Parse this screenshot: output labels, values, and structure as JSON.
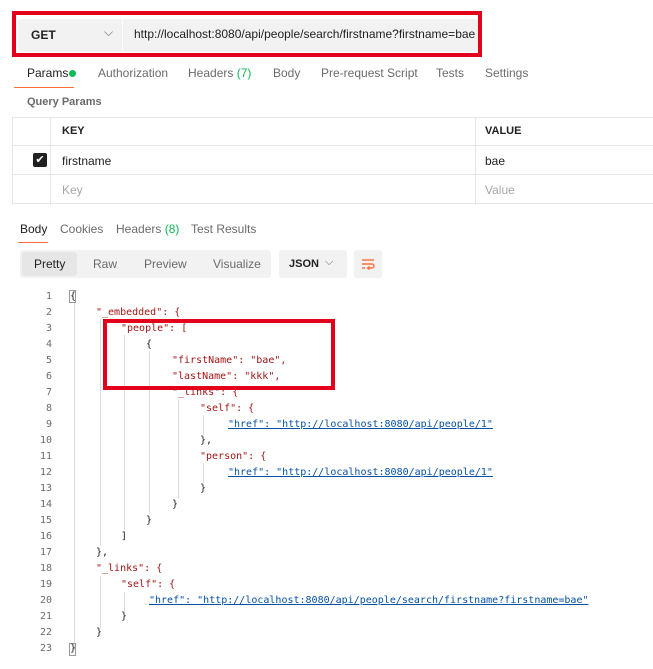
{
  "request": {
    "method": "GET",
    "url": "http://localhost:8080/api/people/search/firstname?firstname=bae"
  },
  "request_tabs": [
    {
      "label": "Params"
    },
    {
      "label": "Authorization"
    },
    {
      "label": "Headers",
      "count": "(7)"
    },
    {
      "label": "Body"
    },
    {
      "label": "Pre-request Script"
    },
    {
      "label": "Tests"
    },
    {
      "label": "Settings"
    }
  ],
  "query_params": {
    "title": "Query Params",
    "columns": [
      "KEY",
      "VALUE"
    ],
    "rows": [
      {
        "key": "firstname",
        "value": "bae",
        "checked": true
      }
    ],
    "placeholder": {
      "key": "Key",
      "value": "Value"
    }
  },
  "response_tabs": [
    {
      "label": "Body"
    },
    {
      "label": "Cookies"
    },
    {
      "label": "Headers",
      "count": "(8)"
    },
    {
      "label": "Test Results"
    }
  ],
  "view_modes": [
    "Pretty",
    "Raw",
    "Preview",
    "Visualize"
  ],
  "format": "JSON",
  "code_lines": [
    "{",
    "\"_embedded\": {",
    "\"people\": [",
    "{",
    "\"firstName\": \"bae\",",
    "\"lastName\": \"kkk\",",
    "\"_links\": {",
    "\"self\": {",
    "\"href\": \"http://localhost:8080/api/people/1\"",
    "},",
    "\"person\": {",
    "\"href\": \"http://localhost:8080/api/people/1\"",
    "}",
    "}",
    "}",
    "]",
    "},",
    "\"_links\": {",
    "\"self\": {",
    "\"href\": \"http://localhost:8080/api/people/search/firstname?firstname=bae\"",
    "}",
    "}",
    "}"
  ],
  "colors": {
    "accent": "#ff6c37",
    "count_green": "#0cbb52",
    "highlight_red": "#e2001a"
  },
  "icons": [
    "chevron-down-icon",
    "checkmark-icon",
    "wrap-lines-icon"
  ]
}
